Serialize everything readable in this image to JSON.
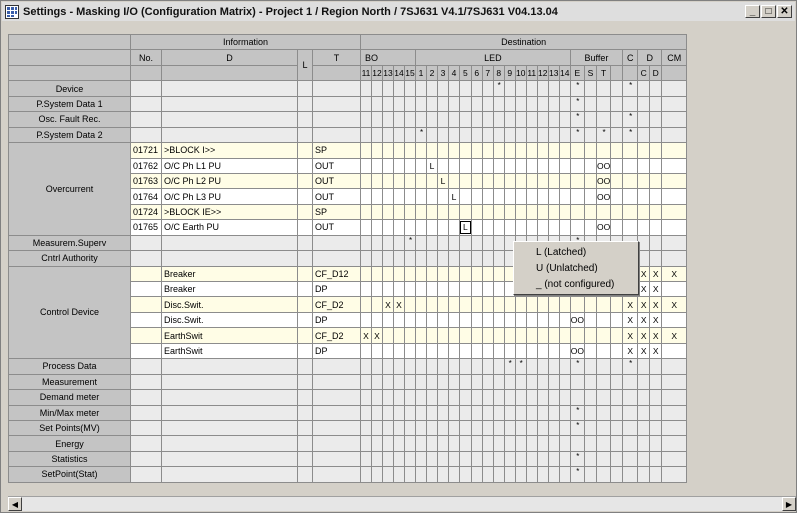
{
  "window": {
    "title": "Settings - Masking I/O (Configuration Matrix) - Project 1 / Region North / 7SJ631 V4.1/7SJ631 V04.13.04",
    "minimize_glyph": "_",
    "maximize_glyph": "□",
    "close_glyph": "✕"
  },
  "header": {
    "information": "Information",
    "destination": "Destination",
    "no": "No.",
    "d": "D",
    "l": "L",
    "t": "T",
    "bo": "BO",
    "led": "LED",
    "buffer": "Buffer",
    "c": "C",
    "dest_d": "D",
    "cm": "CM",
    "bo_cols": [
      "11",
      "12",
      "13",
      "14",
      "15"
    ],
    "led_cols": [
      "1",
      "2",
      "3",
      "4",
      "5",
      "6",
      "7",
      "8",
      "9",
      "10",
      "11",
      "12",
      "13",
      "14"
    ],
    "buffer_cols": [
      "E",
      "S",
      "T"
    ],
    "d_cols": [
      "C",
      "D"
    ]
  },
  "rows": [
    {
      "group": "Device",
      "cells": {
        "led_8": "*",
        "buf_e": "*",
        "c": "*"
      }
    },
    {
      "group": "P.System Data 1",
      "cells": {
        "buf_e": "*"
      }
    },
    {
      "group": "Osc. Fault Rec.",
      "cells": {
        "buf_e": "*",
        "c": "*"
      }
    },
    {
      "group": "P.System Data 2",
      "cells": {
        "led_1": "*",
        "buf_e": "*",
        "buf_t": "*",
        "c": "*"
      }
    },
    {
      "group": "Overcurrent",
      "no": "01721",
      "d": ">BLOCK I>>",
      "t": "SP"
    },
    {
      "group": "Overcurrent",
      "no": "01762",
      "d": "O/C Ph L1 PU",
      "t": "OUT",
      "cells": {
        "led_2": "L",
        "buf_t": "OO"
      }
    },
    {
      "group": "Overcurrent",
      "no": "01763",
      "d": "O/C Ph L2 PU",
      "t": "OUT",
      "cells": {
        "led_3": "L",
        "buf_t": "OO"
      }
    },
    {
      "group": "Overcurrent",
      "no": "01764",
      "d": "O/C Ph L3 PU",
      "t": "OUT",
      "cells": {
        "led_4": "L",
        "buf_t": "OO"
      }
    },
    {
      "group": "Overcurrent",
      "no": "01724",
      "d": ">BLOCK IE>>",
      "t": "SP"
    },
    {
      "group": "Overcurrent",
      "no": "01765",
      "d": "O/C Earth PU",
      "t": "OUT",
      "cells": {
        "led_5": "L",
        "buf_t": "OO"
      }
    },
    {
      "group": "Measurem.Superv",
      "cells": {
        "bo_15": "*",
        "buf_e": "*"
      }
    },
    {
      "group": "Cntrl Authority",
      "cells": {
        "buf_e": "*"
      }
    },
    {
      "group": "Control Device",
      "d": "Breaker",
      "t": "CF_D12",
      "cells": {
        "c": "X",
        "d_c": "X",
        "d_d": "X",
        "cm": "X"
      }
    },
    {
      "group": "Control Device",
      "d": "Breaker",
      "t": "DP",
      "cells": {
        "buf_e": "OO",
        "c": "X",
        "d_c": "X",
        "d_d": "X"
      }
    },
    {
      "group": "Control Device",
      "d": "Disc.Swit.",
      "t": "CF_D2",
      "cells": {
        "bo_13": "X",
        "bo_14": "X",
        "c": "X",
        "d_c": "X",
        "d_d": "X",
        "cm": "X"
      }
    },
    {
      "group": "Control Device",
      "d": "Disc.Swit.",
      "t": "DP",
      "cells": {
        "buf_e": "OO",
        "c": "X",
        "d_c": "X",
        "d_d": "X"
      }
    },
    {
      "group": "Control Device",
      "d": "EarthSwit",
      "t": "CF_D2",
      "cells": {
        "bo_11": "X",
        "bo_12": "X",
        "c": "X",
        "d_c": "X",
        "d_d": "X",
        "cm": "X"
      }
    },
    {
      "group": "Control Device",
      "d": "EarthSwit",
      "t": "DP",
      "cells": {
        "buf_e": "OO",
        "c": "X",
        "d_c": "X",
        "d_d": "X"
      }
    },
    {
      "group": "Process Data",
      "cells": {
        "led_9": "*",
        "led_10": "*",
        "buf_e": "*",
        "c": "*"
      }
    },
    {
      "group": "Measurement"
    },
    {
      "group": "Demand meter"
    },
    {
      "group": "Min/Max meter",
      "cells": {
        "buf_e": "*"
      }
    },
    {
      "group": "Set Points(MV)",
      "cells": {
        "buf_e": "*"
      }
    },
    {
      "group": "Energy"
    },
    {
      "group": "Statistics",
      "cells": {
        "buf_e": "*"
      }
    },
    {
      "group": "SetPoint(Stat)",
      "cells": {
        "buf_e": "*"
      }
    }
  ],
  "popup": {
    "items": [
      "L (Latched)",
      "U (Unlatched)",
      "_ (not configured)"
    ]
  },
  "scrollbar": {
    "left_glyph": "◀",
    "right_glyph": "▶"
  }
}
